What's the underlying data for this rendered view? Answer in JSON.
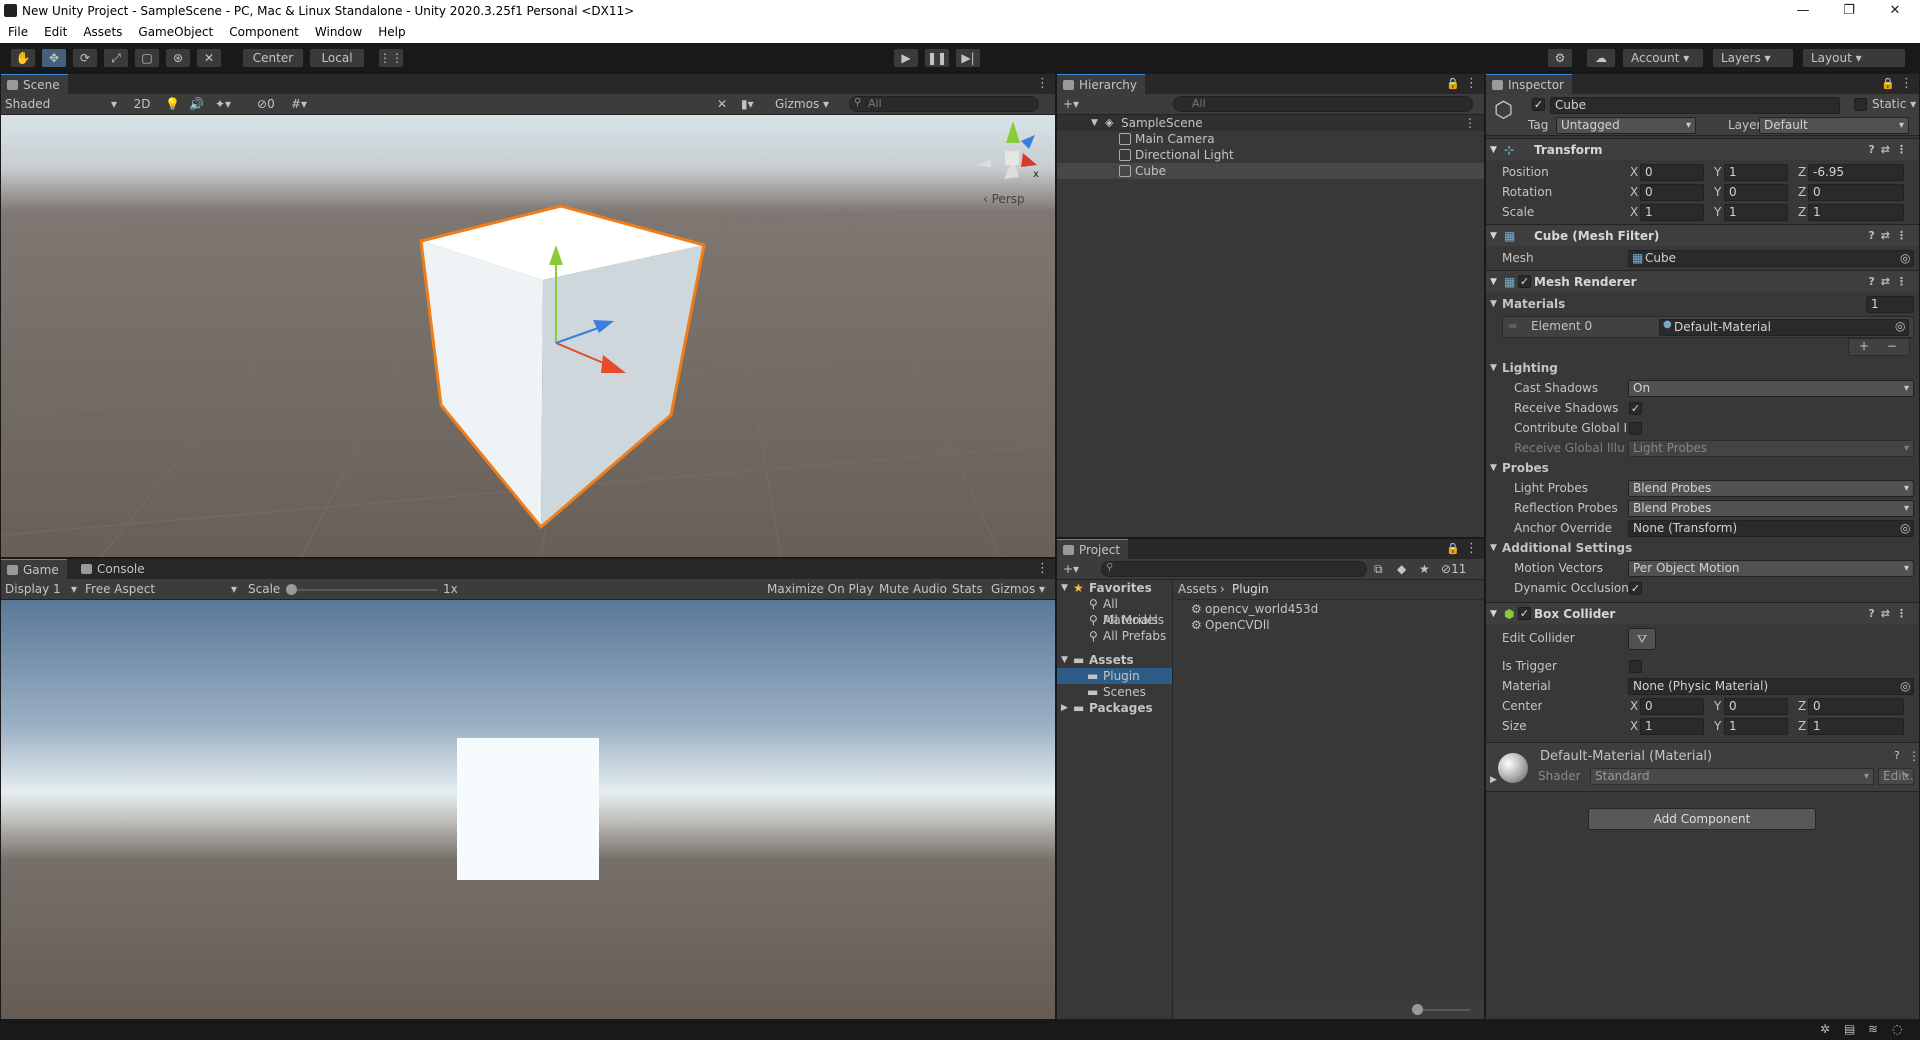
{
  "window": {
    "title": "New Unity Project - SampleScene - PC, Mac & Linux Standalone - Unity 2020.3.25f1 Personal <DX11>",
    "minimize": "—",
    "maximize": "❐",
    "close": "✕"
  },
  "menu": [
    "File",
    "Edit",
    "Assets",
    "GameObject",
    "Component",
    "Window",
    "Help"
  ],
  "toolbar": {
    "pivot_center": "Center",
    "pivot_local": "Local",
    "account": "Account",
    "layers": "Layers",
    "layout": "Layout"
  },
  "scene": {
    "tab": "Scene",
    "shading": "Shaded",
    "mode_2d": "2D",
    "fx_count": "0",
    "gizmos": "Gizmos",
    "search_placeholder": "All",
    "persp": "Persp",
    "gizmo_x": "x"
  },
  "game": {
    "tab": "Game",
    "console_tab": "Console",
    "display": "Display 1",
    "aspect": "Free Aspect",
    "scale_label": "Scale",
    "scale_value": "1x",
    "maximize": "Maximize On Play",
    "mute": "Mute Audio",
    "stats": "Stats",
    "gizmos": "Gizmos"
  },
  "hierarchy": {
    "tab": "Hierarchy",
    "search_placeholder": "All",
    "scene": "SampleScene",
    "items": [
      "Main Camera",
      "Directional Light",
      "Cube"
    ]
  },
  "project": {
    "tab": "Project",
    "hidden_count": "11",
    "favorites": "Favorites",
    "fav_items": [
      "All Materials",
      "All Models",
      "All Prefabs"
    ],
    "assets": "Assets",
    "asset_folders": [
      "Plugin",
      "Scenes"
    ],
    "packages": "Packages",
    "breadcrumb": [
      "Assets",
      "Plugin"
    ],
    "files": [
      "opencv_world453d",
      "OpenCVDll"
    ]
  },
  "inspector": {
    "tab": "Inspector",
    "object_name": "Cube",
    "static_label": "Static",
    "tag_label": "Tag",
    "tag_value": "Untagged",
    "layer_label": "Layer",
    "layer_value": "Default",
    "transform": {
      "title": "Transform",
      "position_label": "Position",
      "position": [
        "0",
        "1",
        "-6.95"
      ],
      "rotation_label": "Rotation",
      "rotation": [
        "0",
        "0",
        "0"
      ],
      "scale_label": "Scale",
      "scale": [
        "1",
        "1",
        "1"
      ],
      "axes": [
        "X",
        "Y",
        "Z"
      ]
    },
    "mesh_filter": {
      "title": "Cube (Mesh Filter)",
      "mesh_label": "Mesh",
      "mesh_value": "Cube"
    },
    "mesh_renderer": {
      "title": "Mesh Renderer",
      "materials_label": "Materials",
      "materials_count": "1",
      "element0_label": "Element 0",
      "element0_value": "Default-Material",
      "plus": "+",
      "minus": "−",
      "lighting": "Lighting",
      "cast_shadows_label": "Cast Shadows",
      "cast_shadows": "On",
      "receive_shadows_label": "Receive Shadows",
      "contribute_gi_label": "Contribute Global Illumina",
      "receive_gi_label": "Receive Global Illuminati",
      "receive_gi_value": "Light Probes",
      "probes": "Probes",
      "light_probes_label": "Light Probes",
      "light_probes": "Blend Probes",
      "reflection_probes_label": "Reflection Probes",
      "reflection_probes": "Blend Probes",
      "anchor_override_label": "Anchor Override",
      "anchor_override": "None (Transform)",
      "additional": "Additional Settings",
      "motion_vectors_label": "Motion Vectors",
      "motion_vectors": "Per Object Motion",
      "dynamic_occlusion_label": "Dynamic Occlusion"
    },
    "box_collider": {
      "title": "Box Collider",
      "edit_collider_label": "Edit Collider",
      "is_trigger_label": "Is Trigger",
      "material_label": "Material",
      "material_value": "None (Physic Material)",
      "center_label": "Center",
      "center": [
        "0",
        "0",
        "0"
      ],
      "size_label": "Size",
      "size": [
        "1",
        "1",
        "1"
      ]
    },
    "material": {
      "title": "Default-Material (Material)",
      "shader_label": "Shader",
      "shader_value": "Standard",
      "edit": "Edit..."
    },
    "add_component": "Add Component"
  },
  "colors": {
    "selection": "#2c5d87",
    "panel": "#383838",
    "accent": "#3c8dde",
    "selection_outline": "#f07d1a"
  }
}
